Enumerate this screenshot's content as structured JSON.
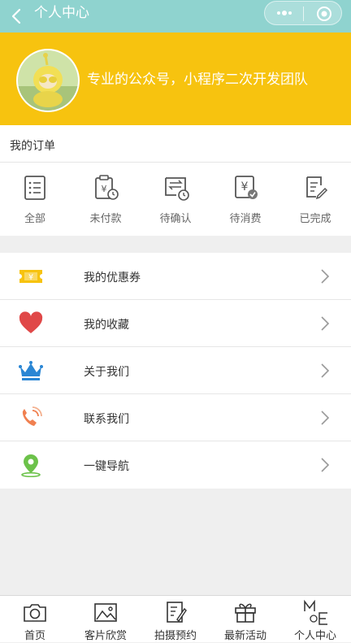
{
  "nav": {
    "title": "个人中心"
  },
  "profile": {
    "description": "专业的公众号，小程序二次开发团队"
  },
  "orders": {
    "header": "我的订单",
    "items": [
      {
        "label": "全部",
        "icon": "list-icon"
      },
      {
        "label": "未付款",
        "icon": "unpaid-clipboard-icon"
      },
      {
        "label": "待确认",
        "icon": "pending-confirm-icon"
      },
      {
        "label": "待消费",
        "icon": "pending-consume-icon"
      },
      {
        "label": "已完成",
        "icon": "completed-edit-icon"
      }
    ]
  },
  "menu": [
    {
      "label": "我的优惠券",
      "icon": "coupon-icon",
      "color": "#f7c30f"
    },
    {
      "label": "我的收藏",
      "icon": "heart-icon",
      "color": "#e04848"
    },
    {
      "label": "关于我们",
      "icon": "crown-icon",
      "color": "#2a86d4"
    },
    {
      "label": "联系我们",
      "icon": "phone-icon",
      "color": "#f08050"
    },
    {
      "label": "一键导航",
      "icon": "location-pin-icon",
      "color": "#6cc24a"
    }
  ],
  "tabbar": [
    {
      "label": "首页",
      "icon": "camera-icon"
    },
    {
      "label": "客片欣赏",
      "icon": "photo-icon"
    },
    {
      "label": "拍摄预约",
      "icon": "edit-note-icon"
    },
    {
      "label": "最新活动",
      "icon": "gift-icon"
    },
    {
      "label": "个人中心",
      "icon": "me-icon"
    }
  ],
  "colors": {
    "nav": "#8fd3cf",
    "profile": "#f7c30f"
  }
}
